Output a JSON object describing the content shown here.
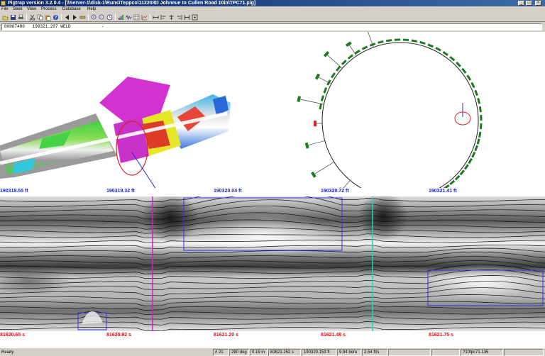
{
  "window": {
    "title": "Pigtrap version 3.2.0.4 - [\\\\Server-1\\disk-1\\Runs\\Teppco\\112203D Johneue to Cullen Road 10in\\TPC71.pig]",
    "minimize_glyph": "_",
    "maximize_glyph": "□",
    "close_glyph": "×"
  },
  "menu": [
    "File",
    "Seek",
    "View",
    "Process",
    "Database",
    "Help"
  ],
  "toolbar": {
    "icons": [
      "open-icon",
      "save-icon",
      "print-icon",
      "cut-icon",
      "copy-icon",
      "paste-icon",
      "help-icon",
      "reverse-icon",
      "play-icon",
      "stop-icon",
      "zoom-in-icon",
      "zoom-out-icon",
      "clock-icon",
      "bar-chart-icon",
      "waveform-icon",
      "grid-icon",
      "chart-icon",
      "distance-icon",
      "align-left-icon",
      "align-center-icon",
      "align-right-icon",
      "fit-width-icon",
      "fit-all-icon"
    ]
  },
  "feature_info": {
    "id": "00067480",
    "distance": "190321.207",
    "type": "WELD",
    "suffix": "-"
  },
  "distance_axis": [
    "190318.55 ft",
    "190319.32 ft",
    "190320.04 ft",
    "190320.72 ft",
    "190321.41 ft"
  ],
  "time_axis": [
    "81620.65 s",
    "81620.92 s",
    "81621.20 s",
    "81621.48 s",
    "81621.75 s"
  ],
  "status": {
    "ready": "Ready",
    "sensor": "# 21",
    "angle": "290 deg",
    "depth": "0.19 in",
    "time": "81621.252 s",
    "distance": "190320.153 ft",
    "bore": "9.94 bore",
    "speed": "2.54 ft/s",
    "file": "?10tpc71.135"
  },
  "colors": {
    "distance_label": "#1e28d2",
    "time_label": "#e0141e",
    "polar_marker": "#1e7a1e",
    "polar_alert": "#e01e1e",
    "marker_magenta": "#c822c8",
    "marker_cyan": "#1ed2d2",
    "defect_box": "#3232e6"
  }
}
